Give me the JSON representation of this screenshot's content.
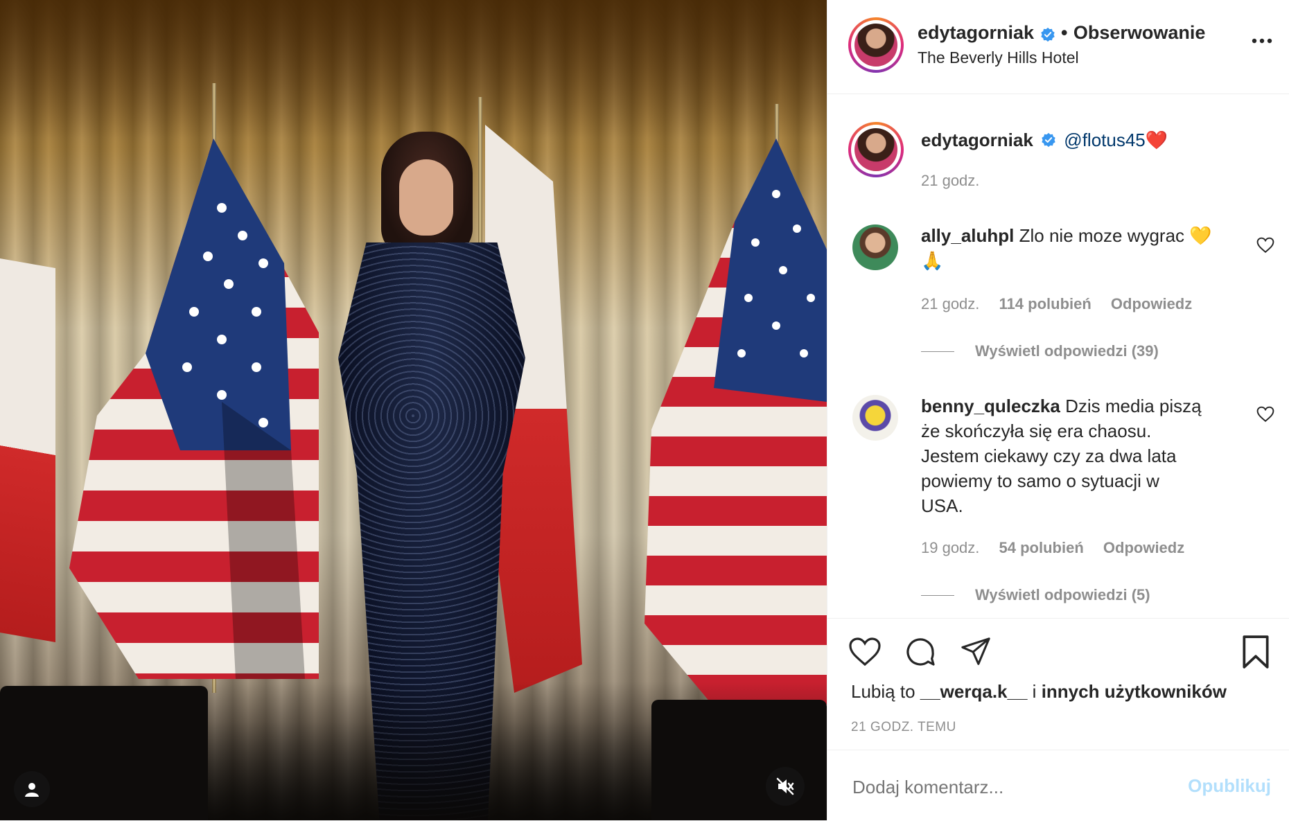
{
  "post": {
    "author": "edytagorniak",
    "follow_status": "Obserwowanie",
    "separator": "•",
    "location": "The Beverly Hills Hotel"
  },
  "caption": {
    "author": "edytagorniak",
    "mention": "@flotus45",
    "emoji": "❤️",
    "time": "21 godz."
  },
  "comments": [
    {
      "author": "ally_aluhpl",
      "text_line1": "Zlo nie moze wygrac 💛",
      "text_line2": "🙏",
      "time": "21 godz.",
      "likes": "114 polubień",
      "reply": "Odpowiedz",
      "view_replies": "Wyświetl odpowiedzi (39)"
    },
    {
      "author": "benny_quleczka",
      "text_line1": "Dzis media piszą",
      "text_line2": "że skończyła się era chaosu.",
      "text_line3": "Jestem ciekawy czy za dwa lata",
      "text_line4": "powiemy to samo o sytuacji w",
      "text_line5": "USA.",
      "time": "19 godz.",
      "likes": "54 polubień",
      "reply": "Odpowiedz",
      "view_replies": "Wyświetl odpowiedzi (5)"
    }
  ],
  "likes": {
    "prefix": "Lubią to",
    "user": "__werqa.k__",
    "joiner": "i",
    "others": "innych użytkowników"
  },
  "timestamp": "21 GODZ. TEMU",
  "composer": {
    "placeholder": "Dodaj komentarz...",
    "publish": "Opublikuj"
  },
  "colors": {
    "verified": "#3897f0",
    "link_blue": "#00376b",
    "publish_disabled": "#b2dffc",
    "muted_text": "#8e8e8e"
  }
}
